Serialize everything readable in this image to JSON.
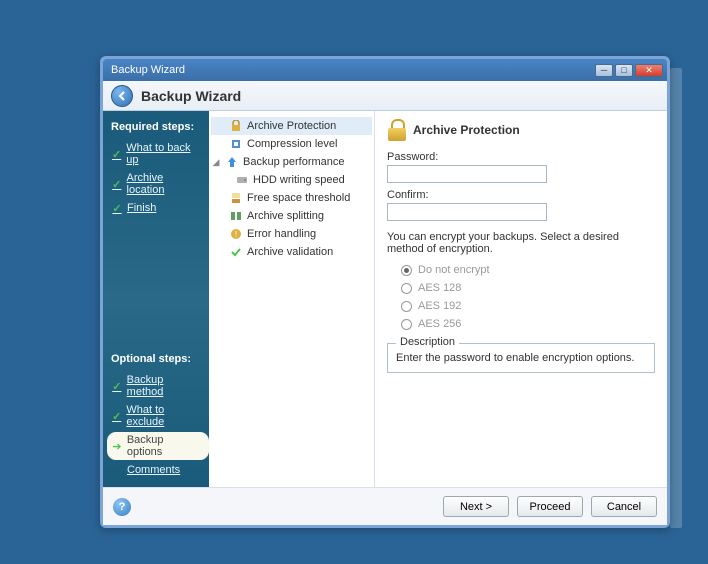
{
  "titlebar": {
    "title": "Backup Wizard"
  },
  "header": {
    "title": "Backup Wizard"
  },
  "sidebar": {
    "required_label": "Required steps:",
    "optional_label": "Optional steps:",
    "required": [
      {
        "label": "What to back up"
      },
      {
        "label": "Archive location"
      },
      {
        "label": "Finish"
      }
    ],
    "optional": [
      {
        "label": "Backup method"
      },
      {
        "label": "What to exclude"
      },
      {
        "label": "Backup options"
      },
      {
        "label": "Comments"
      }
    ]
  },
  "tree": {
    "items": [
      {
        "label": "Archive Protection",
        "icon": "lock"
      },
      {
        "label": "Compression level",
        "icon": "compress"
      },
      {
        "label": "Backup performance",
        "icon": "up-arrow"
      },
      {
        "label": "HDD writing speed",
        "icon": "hdd"
      },
      {
        "label": "Free space threshold",
        "icon": "space"
      },
      {
        "label": "Archive splitting",
        "icon": "split"
      },
      {
        "label": "Error handling",
        "icon": "error"
      },
      {
        "label": "Archive validation",
        "icon": "check"
      }
    ]
  },
  "content": {
    "title": "Archive Protection",
    "password_label": "Password:",
    "confirm_label": "Confirm:",
    "password_value": "",
    "confirm_value": "",
    "info": "You can encrypt your backups. Select a desired method of encryption.",
    "radios": [
      {
        "label": "Do not encrypt"
      },
      {
        "label": "AES 128"
      },
      {
        "label": "AES 192"
      },
      {
        "label": "AES 256"
      }
    ],
    "description_legend": "Description",
    "description_text": "Enter the password to enable encryption options."
  },
  "footer": {
    "next": "Next >",
    "proceed": "Proceed",
    "cancel": "Cancel"
  }
}
